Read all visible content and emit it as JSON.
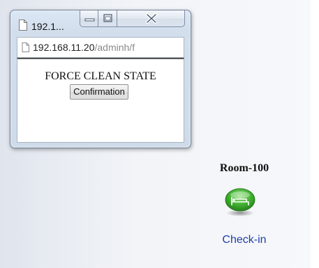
{
  "popup": {
    "title": "192.1...",
    "address_host": "192.168.11.20",
    "address_path": "/adminh/f",
    "heading": "FORCE CLEAN STATE",
    "button_label": "Confirmation",
    "icons": [
      "page-icon",
      "minimize-icon",
      "maximize-icon",
      "close-icon"
    ]
  },
  "room": {
    "name": "Room-100",
    "icon": "bed-icon",
    "status": "Check-in",
    "colors": {
      "icon_green": "#3fae2f",
      "status_link": "#1f3fa6"
    }
  }
}
